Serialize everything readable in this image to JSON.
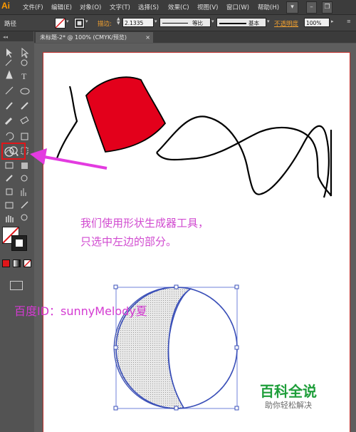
{
  "app": {
    "logo": "Ai"
  },
  "menubar": {
    "items": [
      "文件(F)",
      "编辑(E)",
      "对象(O)",
      "文字(T)",
      "选择(S)",
      "效果(C)",
      "视图(V)",
      "窗口(W)",
      "帮助(H)"
    ]
  },
  "control_bar": {
    "selection_label": "路径",
    "stroke_label": "描边:",
    "stroke_value": "2.1335",
    "profile_label": "等比",
    "brush_label": "基本",
    "opacity_label": "不透明度",
    "opacity_value": "100%"
  },
  "document_tab": {
    "title": "未标题-2* @ 100% (CMYK/预览)",
    "close": "×"
  },
  "canvas": {
    "note_line1": "我们使用形状生成器工具，",
    "note_line2": "只选中左边的部分。",
    "watermark_id": "百度ID：sunnyMelody夏",
    "brand_name": "百科全说",
    "brand_tagline": "助你轻松解决"
  },
  "colors": {
    "ui_dark": "#535353",
    "menubar": "#3c3c3c",
    "accent_orange": "#ff9a00",
    "shape_red": "#e3001b",
    "highlight_red": "#e0161a",
    "annotation_magenta": "#d14bd0",
    "selection_blue": "#3a4fb8",
    "brand_green": "#1e9e3a"
  },
  "tools": [
    "selection-tool",
    "direct-selection-tool",
    "magic-wand-tool",
    "lasso-tool",
    "pen-tool",
    "type-tool",
    "line-tool",
    "ellipse-tool",
    "paintbrush-tool",
    "pencil-tool",
    "blob-brush-tool",
    "eraser-tool",
    "rotate-tool",
    "scale-tool",
    "warp-tool",
    "free-transform-tool",
    "shape-builder-tool",
    "live-paint-tool",
    "perspective-grid-tool",
    "mesh-tool",
    "gradient-tool",
    "eyedropper-tool",
    "blend-tool",
    "symbol-sprayer-tool",
    "graph-tool",
    "artboard-tool",
    "slice-tool",
    "hand-tool",
    "zoom-tool"
  ]
}
